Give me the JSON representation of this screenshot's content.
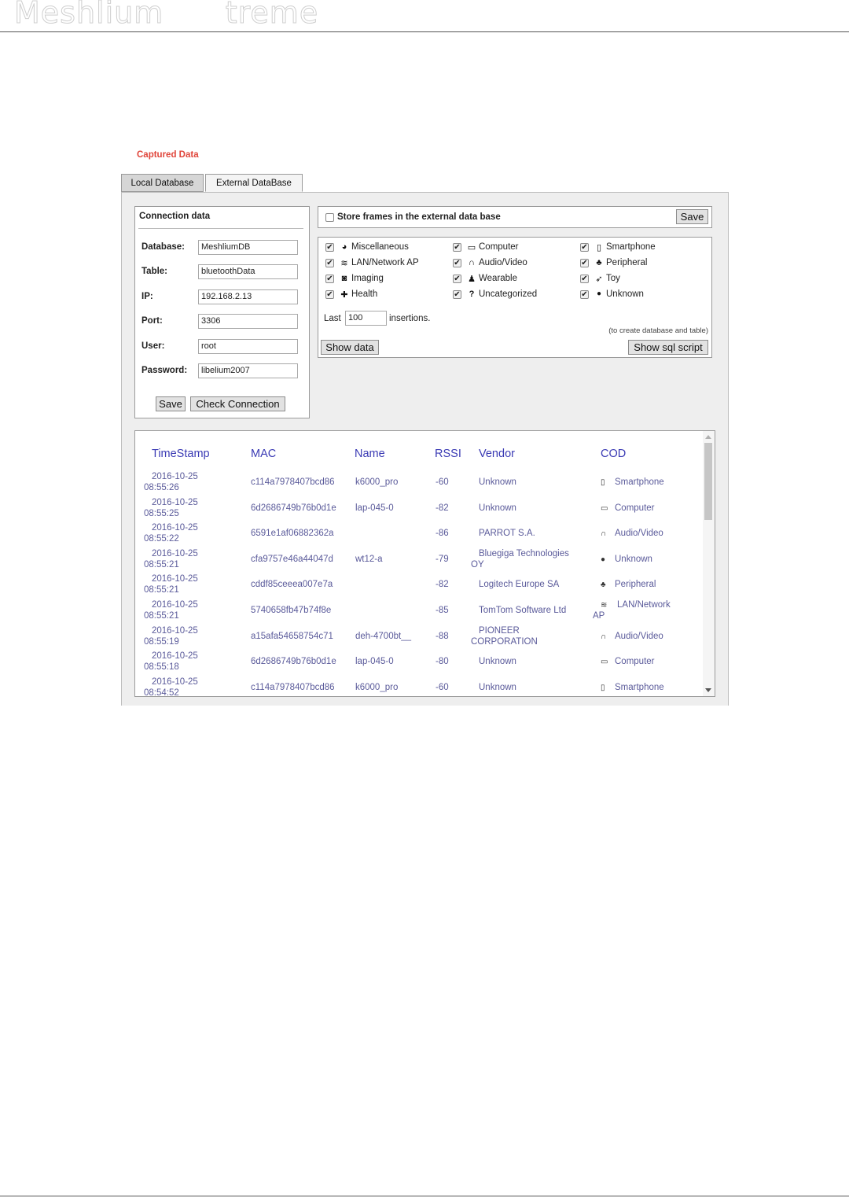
{
  "header": {
    "title": "Meshlium      treme"
  },
  "section_title": "Captured Data",
  "tabs": [
    {
      "label": "Local Database"
    },
    {
      "label": "External DataBase"
    }
  ],
  "connection": {
    "title": "Connection data",
    "fields": [
      {
        "label": "Database:",
        "value": "MeshliumDB"
      },
      {
        "label": "Table:",
        "value": "bluetoothData"
      },
      {
        "label": "IP:",
        "value": "192.168.2.13"
      },
      {
        "label": "Port:",
        "value": "3306"
      },
      {
        "label": "User:",
        "value": "root"
      },
      {
        "label": "Password:",
        "value": "libelium2007"
      }
    ],
    "save_label": "Save",
    "check_label": "Check Connection"
  },
  "store": {
    "label": "Store frames in the external data base",
    "save_label": "Save"
  },
  "filters": {
    "categories": [
      {
        "label": "Miscellaneous",
        "icon": "pie-chart-icon",
        "glyph": "◕"
      },
      {
        "label": "Computer",
        "icon": "laptop-icon",
        "glyph": "💻"
      },
      {
        "label": "Smartphone",
        "icon": "mobile-icon",
        "glyph": "▯"
      },
      {
        "label": "LAN/Network AP",
        "icon": "wifi-icon",
        "glyph": "≋"
      },
      {
        "label": "Audio/Video",
        "icon": "headphones-icon",
        "glyph": "∩"
      },
      {
        "label": "Peripheral",
        "icon": "sitemap-icon",
        "glyph": "♣"
      },
      {
        "label": "Imaging",
        "icon": "camera-icon",
        "glyph": "◙"
      },
      {
        "label": "Wearable",
        "icon": "person-icon",
        "glyph": "♟"
      },
      {
        "label": "Toy",
        "icon": "rocket-icon",
        "glyph": "➶"
      },
      {
        "label": "Health",
        "icon": "plus-icon",
        "glyph": "✚"
      },
      {
        "label": "Uncategorized",
        "icon": "question-icon",
        "glyph": "?"
      },
      {
        "label": "Unknown",
        "icon": "question-circle-icon",
        "glyph": "❓"
      }
    ],
    "last_label": "Last",
    "last_value": "100",
    "insertions_label": "insertions.",
    "note": "(to create database and table)",
    "show_data_label": "Show data",
    "show_sql_label": "Show sql script"
  },
  "table": {
    "columns": [
      "TimeStamp",
      "MAC",
      "Name",
      "RSSI",
      "Vendor",
      "COD"
    ],
    "rows": [
      {
        "date": "2016-10-25",
        "time": "08:55:26",
        "mac": "c114a7978407bcd86",
        "name": "k6000_pro",
        "rssi": "-60",
        "vendor": "Unknown",
        "vendor2": "",
        "cod_icon": "mobile-icon",
        "cod_glyph": "▯",
        "cod": "Smartphone",
        "cod2": ""
      },
      {
        "date": "2016-10-25",
        "time": "08:55:25",
        "mac": "6d2686749b76b0d1e",
        "name": "lap-045-0",
        "rssi": "-82",
        "vendor": "Unknown",
        "vendor2": "",
        "cod_icon": "laptop-icon",
        "cod_glyph": "💻",
        "cod": "Computer",
        "cod2": ""
      },
      {
        "date": "2016-10-25",
        "time": "08:55:22",
        "mac": "6591e1af06882362a",
        "name": "",
        "rssi": "-86",
        "vendor": "PARROT S.A.",
        "vendor2": "",
        "cod_icon": "headphones-icon",
        "cod_glyph": "∩",
        "cod": "Audio/Video",
        "cod2": ""
      },
      {
        "date": "2016-10-25",
        "time": "08:55:21",
        "mac": "cfa9757e46a44047d",
        "name": "wt12-a",
        "rssi": "-79",
        "vendor": "Bluegiga Technologies",
        "vendor2": "OY",
        "cod_icon": "question-circle-icon",
        "cod_glyph": "❓",
        "cod": "Unknown",
        "cod2": ""
      },
      {
        "date": "2016-10-25",
        "time": "08:55:21",
        "mac": "cddf85ceeea007e7a",
        "name": "",
        "rssi": "-82",
        "vendor": "Logitech Europe SA",
        "vendor2": "",
        "cod_icon": "sitemap-icon",
        "cod_glyph": "♣",
        "cod": "Peripheral",
        "cod2": ""
      },
      {
        "date": "2016-10-25",
        "time": "08:55:21",
        "mac": "5740658fb47b74f8e",
        "name": "",
        "rssi": "-85",
        "vendor": "TomTom Software Ltd",
        "vendor2": "",
        "cod_icon": "wifi-icon",
        "cod_glyph": "≋",
        "cod": "LAN/Network",
        "cod2": "AP"
      },
      {
        "date": "2016-10-25",
        "time": "08:55:19",
        "mac": "a15afa54658754c71",
        "name": "deh-4700bt__",
        "rssi": "-88",
        "vendor": "PIONEER",
        "vendor2": "CORPORATION",
        "cod_icon": "headphones-icon",
        "cod_glyph": "∩",
        "cod": "Audio/Video",
        "cod2": ""
      },
      {
        "date": "2016-10-25",
        "time": "08:55:18",
        "mac": "6d2686749b76b0d1e",
        "name": "lap-045-0",
        "rssi": "-80",
        "vendor": "Unknown",
        "vendor2": "",
        "cod_icon": "laptop-icon",
        "cod_glyph": "💻",
        "cod": "Computer",
        "cod2": ""
      },
      {
        "date": "2016-10-25",
        "time": "08:54:52",
        "mac": "c114a7978407bcd86",
        "name": "k6000_pro",
        "rssi": "-60",
        "vendor": "Unknown",
        "vendor2": "",
        "cod_icon": "mobile-icon",
        "cod_glyph": "▯",
        "cod": "Smartphone",
        "cod2": ""
      }
    ]
  }
}
